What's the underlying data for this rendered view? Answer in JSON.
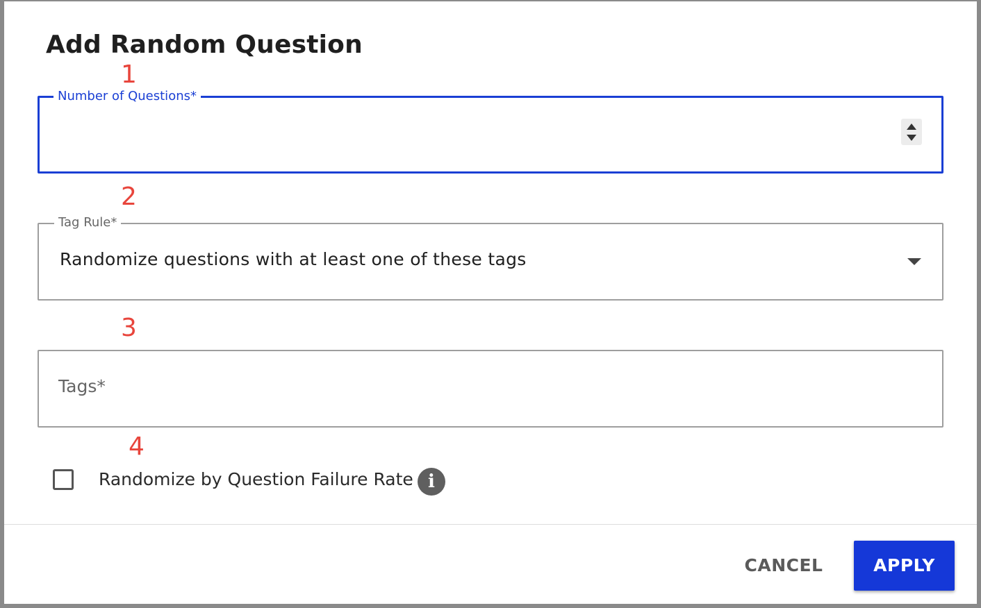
{
  "dialog": {
    "title": "Add Random Question",
    "annotations": [
      "1",
      "2",
      "3",
      "4"
    ]
  },
  "number_of_questions": {
    "label": "Number of Questions*",
    "value": "",
    "stepper_icon": "spinner-arrows-icon"
  },
  "tag_rule": {
    "label": "Tag Rule*",
    "selected": "Randomize questions with at least one of these tags",
    "dropdown_icon": "caret-down-icon"
  },
  "tags": {
    "placeholder": "Tags*"
  },
  "failure_rate": {
    "label": "Randomize by Question Failure Rate",
    "checked": false,
    "info_icon": "info-icon",
    "info_glyph": "i"
  },
  "actions": {
    "cancel_label": "CANCEL",
    "apply_label": "APPLY"
  },
  "colors": {
    "accent": "#1a3fd4",
    "apply_button": "#1538d8",
    "annotation": "#e8453c"
  }
}
